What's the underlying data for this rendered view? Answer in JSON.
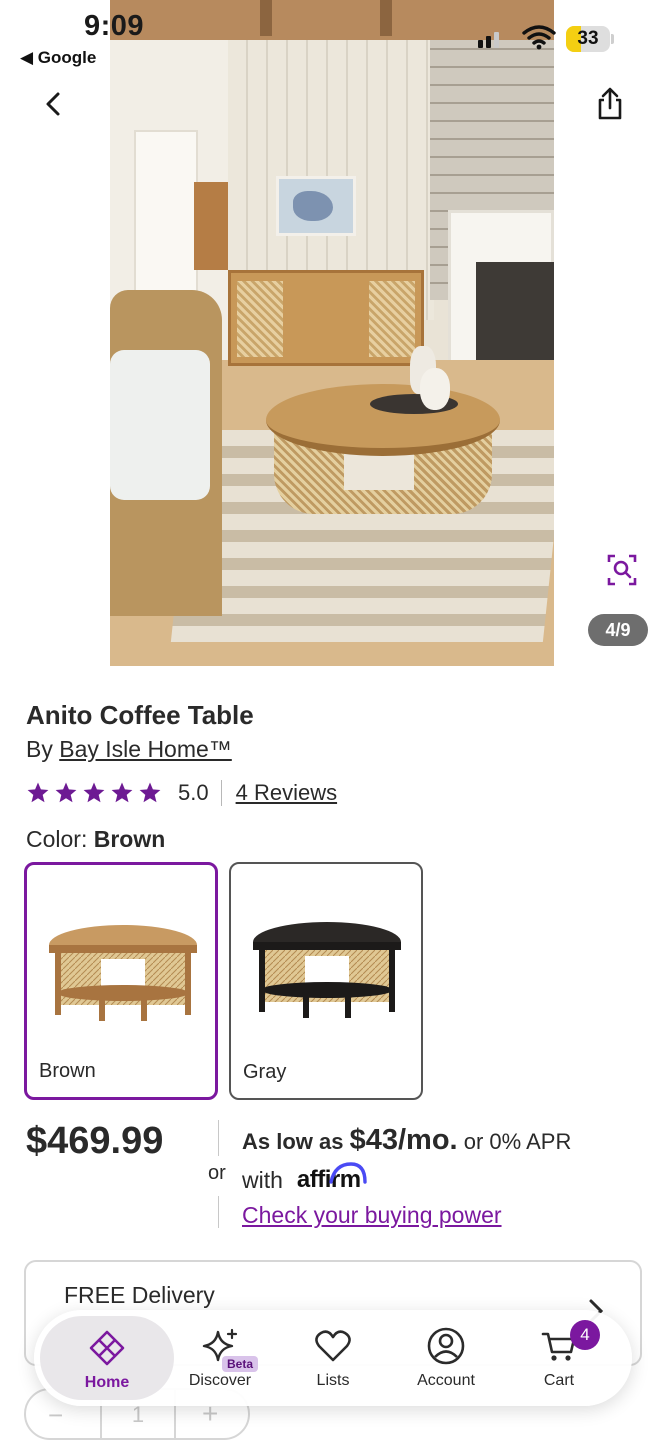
{
  "status_bar": {
    "time": "9:09",
    "back_app": "◀ Google",
    "battery_level": "33",
    "battery_fraction": 0.33
  },
  "gallery": {
    "counter": "4/9"
  },
  "product": {
    "title": "Anito Coffee Table",
    "by_prefix": "By",
    "brand": "Bay Isle Home™",
    "rating_value": "5.0",
    "star_count": 5,
    "reviews_label": "4 Reviews",
    "color_label_prefix": "Color:",
    "selected_color": "Brown",
    "colors": [
      {
        "label": "Brown"
      },
      {
        "label": "Gray"
      }
    ]
  },
  "pricing": {
    "price": "$469.99",
    "or": "or",
    "as_low_as": "As low as",
    "monthly": "$43/mo.",
    "apr": "or 0% APR",
    "with": "with",
    "affirm": "affirm",
    "buying_power_link": "Check your buying power"
  },
  "delivery": {
    "title": "FREE Delivery"
  },
  "quantity": {
    "minus": "−",
    "value": "1",
    "plus": "+"
  },
  "tab_bar": {
    "home": "Home",
    "discover": "Discover",
    "beta": "Beta",
    "lists": "Lists",
    "account": "Account",
    "cart": "Cart",
    "cart_count": "4"
  },
  "colors": {
    "accent": "#7b189f",
    "star": "#6d1a93",
    "battery": "#f4cf12"
  }
}
